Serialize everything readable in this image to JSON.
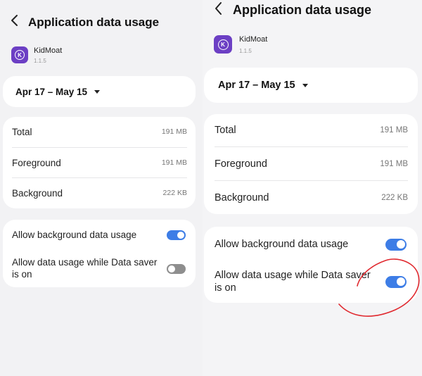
{
  "screen": {
    "title": "Application data usage",
    "back_icon": "chevron-left-icon",
    "app": {
      "name": "KidMoat",
      "version": "1.1.5",
      "icon_letter": "K",
      "icon_color": "#6c3fc4"
    },
    "date_range": "Apr 17 – May 15",
    "usage": [
      {
        "label": "Total",
        "value": "191 MB"
      },
      {
        "label": "Foreground",
        "value": "191 MB"
      },
      {
        "label": "Background",
        "value": "222 KB"
      }
    ],
    "toggles": {
      "background_data": {
        "label": "Allow background data usage"
      },
      "data_saver": {
        "label": "Allow data usage while Data saver is on"
      }
    }
  },
  "states": {
    "left": {
      "background_data": true,
      "data_saver": false
    },
    "right": {
      "background_data": true,
      "data_saver": true
    }
  },
  "colors": {
    "accent": "#3d7de6",
    "switch_off": "#8e8e8e",
    "annotation": "#e0282e"
  }
}
